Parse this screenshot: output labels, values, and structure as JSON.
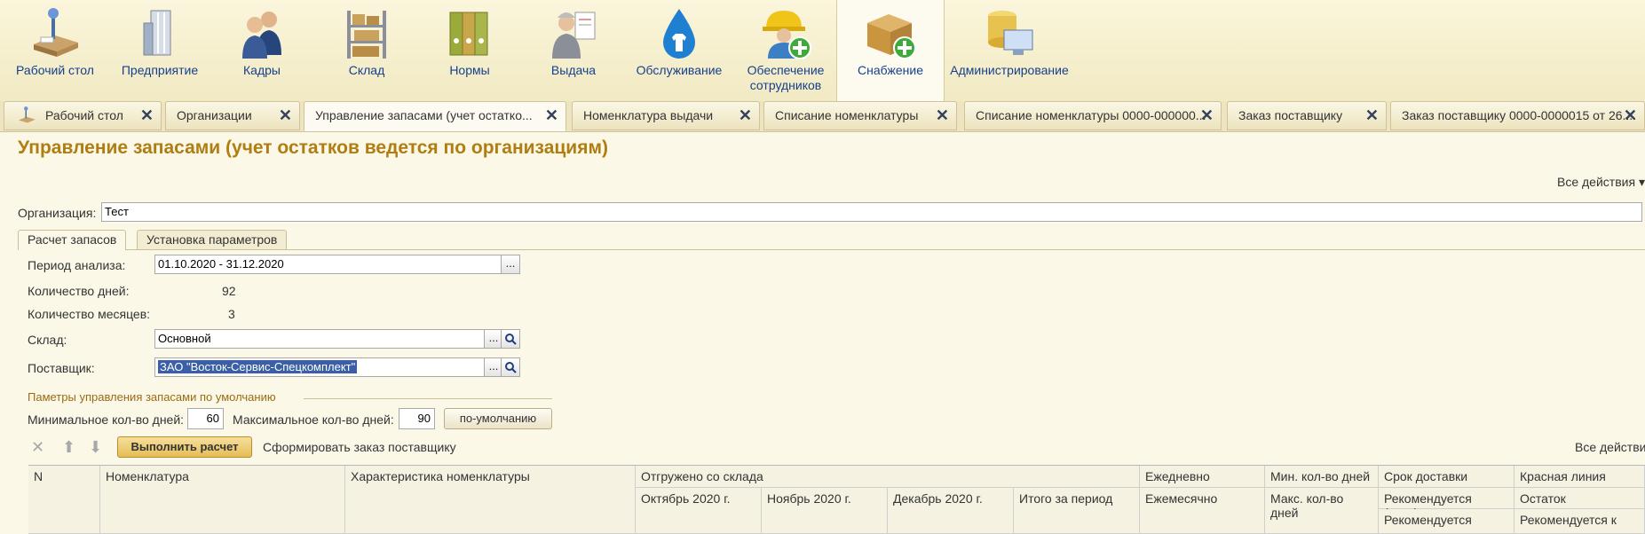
{
  "sections": [
    {
      "label": "Рабочий стол",
      "icon": "desk-icon"
    },
    {
      "label": "Предприятие",
      "icon": "building-icon"
    },
    {
      "label": "Кадры",
      "icon": "people-icon"
    },
    {
      "label": "Склад",
      "icon": "shelves-icon"
    },
    {
      "label": "Нормы",
      "icon": "folders-icon"
    },
    {
      "label": "Выдача",
      "icon": "worker-icon"
    },
    {
      "label": "Обслуживание",
      "icon": "drop-shirt-icon"
    },
    {
      "label": "Обеспечение сотрудников",
      "icon": "helmet-add-icon"
    },
    {
      "label": "Снабжение",
      "icon": "box-add-icon"
    },
    {
      "label": "Администрирование",
      "icon": "database-computer-icon"
    }
  ],
  "window_tabs": [
    {
      "label": "Рабочий стол"
    },
    {
      "label": "Организации"
    },
    {
      "label": "Управление запасами (учет остатко..."
    },
    {
      "label": "Номенклатура выдачи"
    },
    {
      "label": "Списание номенклатуры"
    },
    {
      "label": "Списание номенклатуры 0000-000000..."
    },
    {
      "label": "Заказ поставщику"
    },
    {
      "label": "Заказ поставщику 0000-0000015 от 26...."
    }
  ],
  "form": {
    "title": "Управление запасами (учет остатков ведется по организациям)",
    "all_actions": "Все действия",
    "org_label": "Организация:",
    "org_value": "Тест",
    "tabs": [
      "Расчет запасов",
      "Установка параметров"
    ],
    "period_label": "Период анализа:",
    "period_value": "01.10.2020 - 31.12.2020",
    "days_label": "Количество дней:",
    "days_value": "92",
    "months_label": "Количество месяцев:",
    "months_value": "3",
    "warehouse_label": "Склад:",
    "warehouse_value": "Основной",
    "supplier_label": "Поставщик:",
    "supplier_value": "ЗАО \"Восток-Сервис-Спецкомплект\"",
    "ellipsis": "...",
    "group_title": "Паметры управления запасами по умолчанию",
    "min_days_label": "Минимальное кол-во дней:",
    "min_days_value": "60",
    "max_days_label": "Максимальное кол-во дней:",
    "max_days_value": "90",
    "default_button": "по-умолчанию"
  },
  "toolbar": {
    "calc_button": "Выполнить расчет",
    "order_link": "Сформировать заказ поставщику",
    "all_actions": "Все действи"
  },
  "table_header": {
    "n": "N",
    "nomenclature": "Номенклатура",
    "characteristic": "Характеристика номенклатуры",
    "shipped": "Отгружено со склада",
    "oct": "Октябрь 2020 г.",
    "nov": "Ноябрь 2020 г.",
    "dec": "Декабрь 2020 г.",
    "total": "Итого за период",
    "daily": "Ежедневно",
    "monthly": "Ежемесячно",
    "min_days": "Мин. кол-во дней",
    "max_days": "Макс. кол-во дней",
    "delivery": "Срок доставки",
    "rec_min": "Рекомендуется (мин.)",
    "rec": "Рекомендуется",
    "red_line": "Красная линия",
    "stock": "Остаток",
    "rec_to": "Рекомендуется к"
  }
}
